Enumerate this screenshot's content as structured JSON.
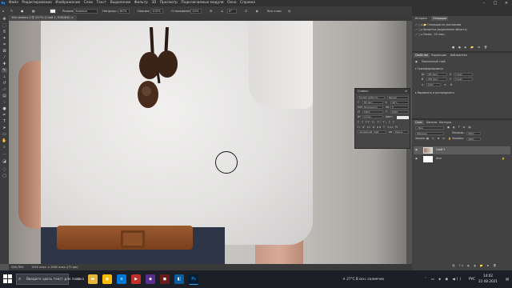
{
  "menubar": {
    "app_logo": "Ps",
    "items": [
      "Файл",
      "Редактирование",
      "Изображение",
      "Слои",
      "Текст",
      "Выделение",
      "Фильтр",
      "3D",
      "Просмотр",
      "Подключаемые модули",
      "Окно",
      "Справка"
    ]
  },
  "options": {
    "mode_label": "Режим:",
    "mode_value": "Замена",
    "opacity_label": "Непрозр.:",
    "opacity_value": "80%",
    "pressure_label": "Нажим:",
    "pressure_value": "100%",
    "smoothing_label": "Сглаживание:",
    "smoothing_value": "10%",
    "angle_value": "0°",
    "all_layers_label": "Все слои"
  },
  "document": {
    "tab_label": "Без имени-1 @ 257% (Слой 1, RGB/8#)",
    "zoom": "256,78%",
    "doc_size": "1920 пикс. x 1080 пикс. (72 ppi)"
  },
  "dock": {
    "history_tabs": [
      "История",
      "Операции"
    ],
    "history_items": [
      "Операции по умолчанию",
      "Виньетка (выделенная область)",
      "Рамка - 50 пикс."
    ],
    "properties_tabs": [
      "Свойства",
      "Коррекция",
      "Библиотеки"
    ],
    "layer_type": "Пиксельный слой",
    "transform_label": "Трансформировать",
    "w_value": "425 пикс.",
    "h_value": "239 пикс.",
    "x_value": "1 пикс.",
    "y_value": "2 пикс.",
    "angle_value": "0,00°",
    "align_label": "Выровнять и распределить",
    "layers_tabs": [
      "Слои",
      "Каналы",
      "Контуры"
    ],
    "kind_label": "Вид",
    "blend_mode": "Обычные",
    "opacity_label": "Непрозр.:",
    "opacity_value": "100%",
    "lock_label": "Закреп.:",
    "fill_label": "Заливка:",
    "fill_value": "100%",
    "layers": [
      {
        "name": "Слой 1",
        "selected": true
      },
      {
        "name": "Фон",
        "selected": false
      }
    ]
  },
  "character": {
    "title": "Символ",
    "font_family": "Franklin Gothic M...",
    "font_style": "Regular",
    "size": "66 пикс.",
    "leading": "Авто",
    "kerning": "Метрически",
    "tracking": "0",
    "v_scale": "100%",
    "h_scale": "100%",
    "baseline": "0 пикс.",
    "color_label": "Цвет:",
    "language": "Английский: США",
    "aa_label": "aa",
    "aa_value": "Резкое"
  },
  "taskbar": {
    "search_placeholder": "Введите здесь текст для поиска",
    "weather": "27°C  В осн. солнечно",
    "lang": "РУС",
    "time": "14:02",
    "date": "22.08.2021"
  },
  "colors": {
    "accent": "#31a8ff",
    "panel": "#424242",
    "dock_bg": "#323232",
    "taskbar": "#1d1f26"
  }
}
